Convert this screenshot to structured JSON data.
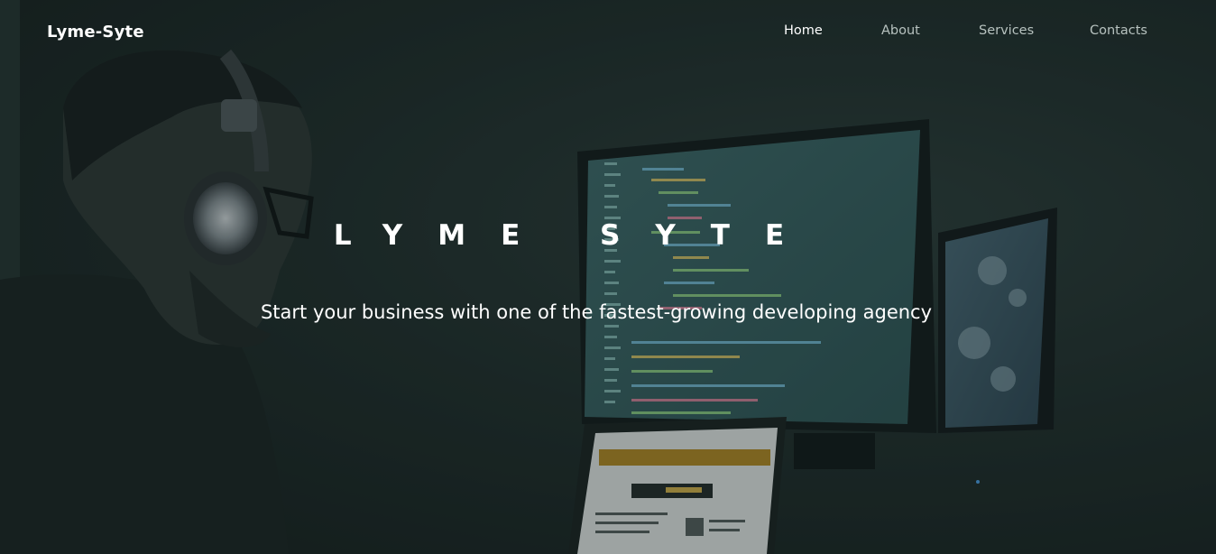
{
  "brand": "Lyme-Syte",
  "nav": {
    "home": "Home",
    "about": "About",
    "services": "Services",
    "contacts": "Contacts"
  },
  "hero": {
    "title": "LYME SYTE",
    "subtitle": "Start your business with one of the fastest-growing developing agency"
  },
  "colors": {
    "background": "#1f2c2a",
    "text": "#ffffff",
    "nav_inactive": "#b7c2bf",
    "code_screen": "#3e6a6c"
  }
}
